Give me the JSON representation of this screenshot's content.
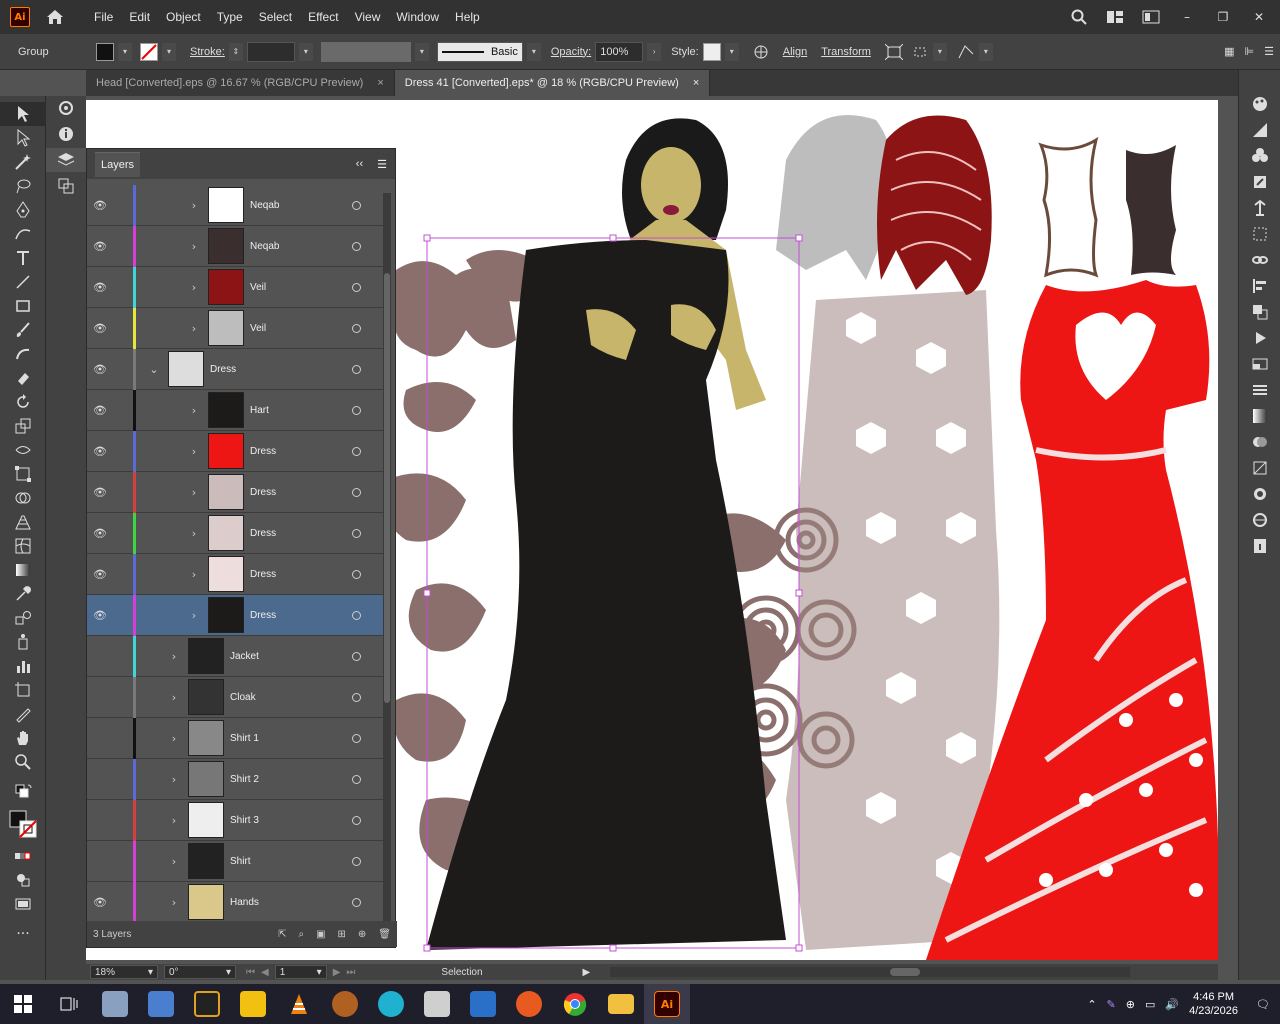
{
  "menubar": {
    "logo": "Ai",
    "items": [
      "File",
      "Edit",
      "Object",
      "Type",
      "Select",
      "Effect",
      "View",
      "Window",
      "Help"
    ]
  },
  "control": {
    "selection_type": "Group",
    "stroke_label": "Stroke:",
    "brush_label": "Basic",
    "opacity_label": "Opacity:",
    "opacity_value": "100%",
    "style_label": "Style:",
    "align_label": "Align",
    "transform_label": "Transform"
  },
  "tabs": [
    {
      "label": "Head [Converted].eps @ 16.67 % (RGB/CPU Preview)",
      "close": "×"
    },
    {
      "label": "Dress 41 [Converted].eps* @ 18 % (RGB/CPU Preview)",
      "close": "×"
    }
  ],
  "layers": {
    "title": "Layers",
    "rows": [
      {
        "name": "Neqab",
        "visible": true,
        "color": "#5b6bd6"
      },
      {
        "name": "Neqab",
        "visible": true,
        "color": "#d63fd6"
      },
      {
        "name": "Veil",
        "visible": true,
        "color": "#3fd6d6"
      },
      {
        "name": "Veil",
        "visible": true,
        "color": "#e6e63f"
      },
      {
        "name": "Dress",
        "visible": true,
        "color": "#7a7a7a"
      },
      {
        "name": "Hart",
        "visible": true,
        "color": "#111111"
      },
      {
        "name": "Dress",
        "visible": true,
        "color": "#5b6bd6"
      },
      {
        "name": "Dress",
        "visible": true,
        "color": "#d63f3f"
      },
      {
        "name": "Dress",
        "visible": true,
        "color": "#3fd63f"
      },
      {
        "name": "Dress",
        "visible": true,
        "color": "#5b6bd6"
      },
      {
        "name": "Dress",
        "visible": true,
        "color": "#d63fd6"
      },
      {
        "name": "Jacket",
        "visible": false,
        "color": "#3fd6d6"
      },
      {
        "name": "Cloak",
        "visible": false,
        "color": "#7a7a7a"
      },
      {
        "name": "Shirt 1",
        "visible": false,
        "color": "#111111"
      },
      {
        "name": "Shirt 2",
        "visible": false,
        "color": "#5b6bd6"
      },
      {
        "name": "Shirt 3",
        "visible": false,
        "color": "#d63f3f"
      },
      {
        "name": "Shirt",
        "visible": false,
        "color": "#d63fd6"
      },
      {
        "name": "Hands",
        "visible": true,
        "color": "#d63fd6"
      }
    ],
    "footer": "3 Layers"
  },
  "status": {
    "zoom": "18%",
    "rotation": "0°",
    "artboard": "1",
    "tool": "Selection"
  },
  "taskbar": {
    "time": "4:46 PM",
    "date": "4/23/2026"
  },
  "colors": {
    "accent_red": "#ee1111",
    "dress_black": "#1d1a1a",
    "lace_brown": "#8a6f6c",
    "selection": "#c44dd6"
  }
}
